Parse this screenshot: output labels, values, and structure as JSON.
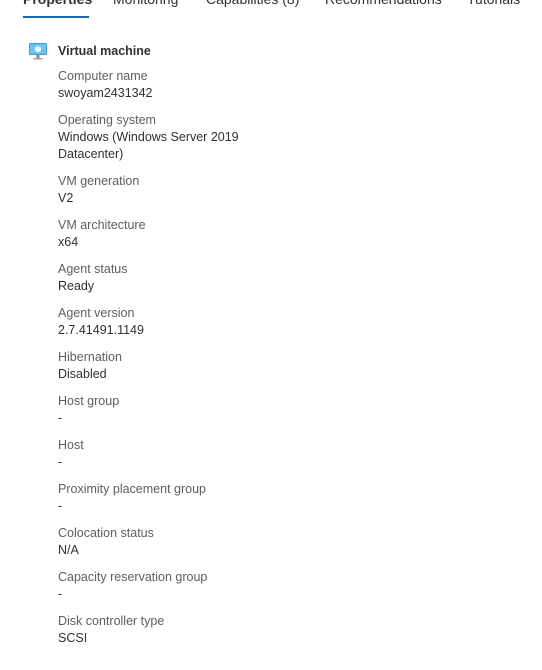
{
  "tabs": [
    {
      "label": "Properties",
      "active": true
    },
    {
      "label": "Monitoring",
      "active": false
    },
    {
      "label": "Capabilities (8)",
      "active": false
    },
    {
      "label": "Recommendations",
      "active": false
    },
    {
      "label": "Tutorials",
      "active": false
    }
  ],
  "section": {
    "title": "Virtual machine",
    "icon": "virtual-machine-icon"
  },
  "properties": [
    {
      "label": "Computer name",
      "value": "swoyam2431342"
    },
    {
      "label": "Operating system",
      "value": "Windows (Windows Server 2019 Datacenter)"
    },
    {
      "label": "VM generation",
      "value": "V2"
    },
    {
      "label": "VM architecture",
      "value": "x64"
    },
    {
      "label": "Agent status",
      "value": "Ready"
    },
    {
      "label": "Agent version",
      "value": "2.7.41491.1149"
    },
    {
      "label": "Hibernation",
      "value": "Disabled"
    },
    {
      "label": "Host group",
      "value": "-"
    },
    {
      "label": "Host",
      "value": "-"
    },
    {
      "label": "Proximity placement group",
      "value": "-"
    },
    {
      "label": "Colocation status",
      "value": "N/A"
    },
    {
      "label": "Capacity reservation group",
      "value": "-"
    },
    {
      "label": "Disk controller type",
      "value": "SCSI"
    }
  ],
  "colors": {
    "accent": "#0f6cbd",
    "text": "#323130",
    "label": "#605e5c"
  }
}
